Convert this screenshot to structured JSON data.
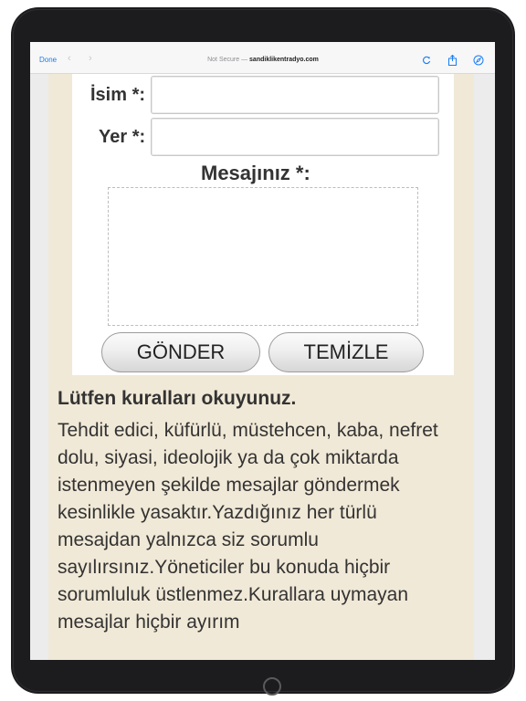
{
  "browser": {
    "done_label": "Done",
    "back_arrow": "‹",
    "forward_arrow": "›",
    "security_label": "Not Secure —",
    "domain": "sandiklikentradyo.com",
    "icons": [
      "reload-icon",
      "share-icon",
      "compass-icon"
    ]
  },
  "form": {
    "name_label": "İsim *:",
    "place_label": "Yer *:",
    "message_label": "Mesajınız *:",
    "name_value": "",
    "place_value": "",
    "message_value": "",
    "submit_label": "GÖNDER",
    "reset_label": "TEMİZLE"
  },
  "rules": {
    "title": "Lütfen kuralları okuyunuz.",
    "body": "Tehdit edici, küfürlü, müstehcen, kaba, nefret dolu, siyasi, ideolojik ya da çok miktarda istenmeyen şekilde mesajlar göndermek kesinlikle yasaktır.Yazdığınız her türlü mesajdan yalnızca siz sorumlu sayılırsınız.Yöneticiler bu konuda hiçbir sorumluluk üstlenmez.Kurallara uymayan mesajlar hiçbir ayırım"
  },
  "colors": {
    "accent": "#1a7cf5",
    "page_background": "#f1e9d7",
    "device_frame": "#1c1c1e"
  }
}
